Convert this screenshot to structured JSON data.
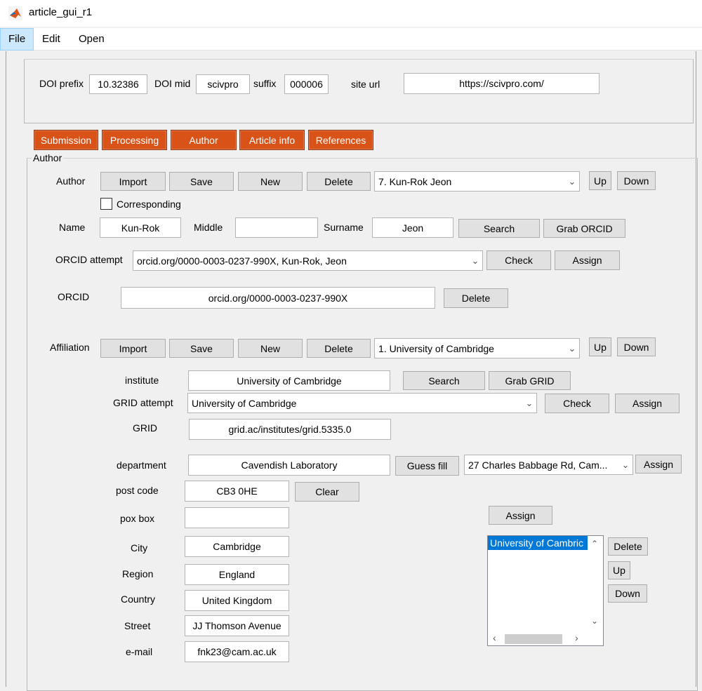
{
  "window": {
    "title": "article_gui_r1"
  },
  "menu": {
    "file": "File",
    "edit": "Edit",
    "open": "Open"
  },
  "doi": {
    "prefix_label": "DOI prefix",
    "prefix_value": "10.32386",
    "mid_label": "DOI mid",
    "mid_value": "scivpro",
    "suffix_label": "suffix",
    "suffix_value": "000006",
    "site_label": "site url",
    "site_value": "https://scivpro.com/"
  },
  "tabs": [
    "Submission",
    "Processing",
    "Author",
    "Article info",
    "References"
  ],
  "author_panel": {
    "title": "Author",
    "author_label": "Author",
    "import": "Import",
    "save": "Save",
    "new": "New",
    "delete": "Delete",
    "author_select": "7. Kun-Rok Jeon",
    "up": "Up",
    "down": "Down",
    "corresponding": "Corresponding",
    "name_label": "Name",
    "name_value": "Kun-Rok",
    "middle_label": "Middle",
    "middle_value": "",
    "surname_label": "Surname",
    "surname_value": "Jeon",
    "search": "Search",
    "grab_orcid": "Grab ORCID",
    "orcid_attempt_label": "ORCID attempt",
    "orcid_attempt_value": "orcid.org/0000-0003-0237-990X, Kun-Rok, Jeon",
    "check": "Check",
    "assign": "Assign",
    "orcid_label": "ORCID",
    "orcid_value": "orcid.org/0000-0003-0237-990X",
    "orcid_delete": "Delete"
  },
  "affiliation": {
    "label": "Affiliation",
    "import": "Import",
    "save": "Save",
    "new": "New",
    "delete": "Delete",
    "select": "1. University of Cambridge",
    "up": "Up",
    "down": "Down",
    "institute_label": "institute",
    "institute_value": "University of Cambridge",
    "search": "Search",
    "grab_grid": "Grab GRID",
    "grid_attempt_label": "GRID attempt",
    "grid_attempt_value": "University of Cambridge",
    "check": "Check",
    "assign": "Assign",
    "grid_label": "GRID",
    "grid_value": "grid.ac/institutes/grid.5335.0",
    "department_label": "department",
    "department_value": "Cavendish Laboratory",
    "guess_fill": "Guess fill",
    "address_select": "27 Charles Babbage Rd, Cam...",
    "address_assign": "Assign",
    "postcode_label": "post code",
    "postcode_value": "CB3 0HE",
    "clear": "Clear",
    "poxbox_label": "pox box",
    "poxbox_value": "",
    "list_assign": "Assign",
    "city_label": "City",
    "city_value": "Cambridge",
    "region_label": "Region",
    "region_value": "England",
    "country_label": "Country",
    "country_value": "United Kingdom",
    "street_label": "Street",
    "street_value": "JJ Thomson Avenue",
    "email_label": "e-mail",
    "email_value": "fnk23@cam.ac.uk",
    "list_items": [
      "University of Cambric"
    ],
    "list_delete": "Delete",
    "list_up": "Up",
    "list_down": "Down"
  }
}
